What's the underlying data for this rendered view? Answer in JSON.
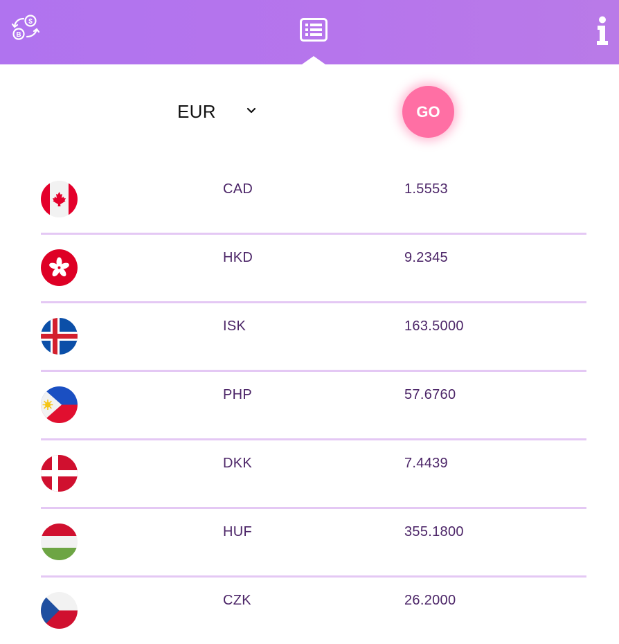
{
  "header": {
    "icons": [
      "currency-exchange-icon",
      "list-icon",
      "info-icon"
    ],
    "background": "#b675ec"
  },
  "controls": {
    "selected_currency": "EUR",
    "go_label": "GO",
    "go_color": "#ff6fa4"
  },
  "rates": [
    {
      "code": "CAD",
      "value": "1.5553",
      "flag": "canada-flag-icon"
    },
    {
      "code": "HKD",
      "value": "9.2345",
      "flag": "hong-kong-flag-icon"
    },
    {
      "code": "ISK",
      "value": "163.5000",
      "flag": "iceland-flag-icon"
    },
    {
      "code": "PHP",
      "value": "57.6760",
      "flag": "philippines-flag-icon"
    },
    {
      "code": "DKK",
      "value": "7.4439",
      "flag": "denmark-flag-icon"
    },
    {
      "code": "HUF",
      "value": "355.1800",
      "flag": "hungary-flag-icon"
    },
    {
      "code": "CZK",
      "value": "26.2000",
      "flag": "czech-flag-icon"
    }
  ],
  "colors": {
    "text": "#4b2467",
    "divider": "#e4c8f4"
  }
}
